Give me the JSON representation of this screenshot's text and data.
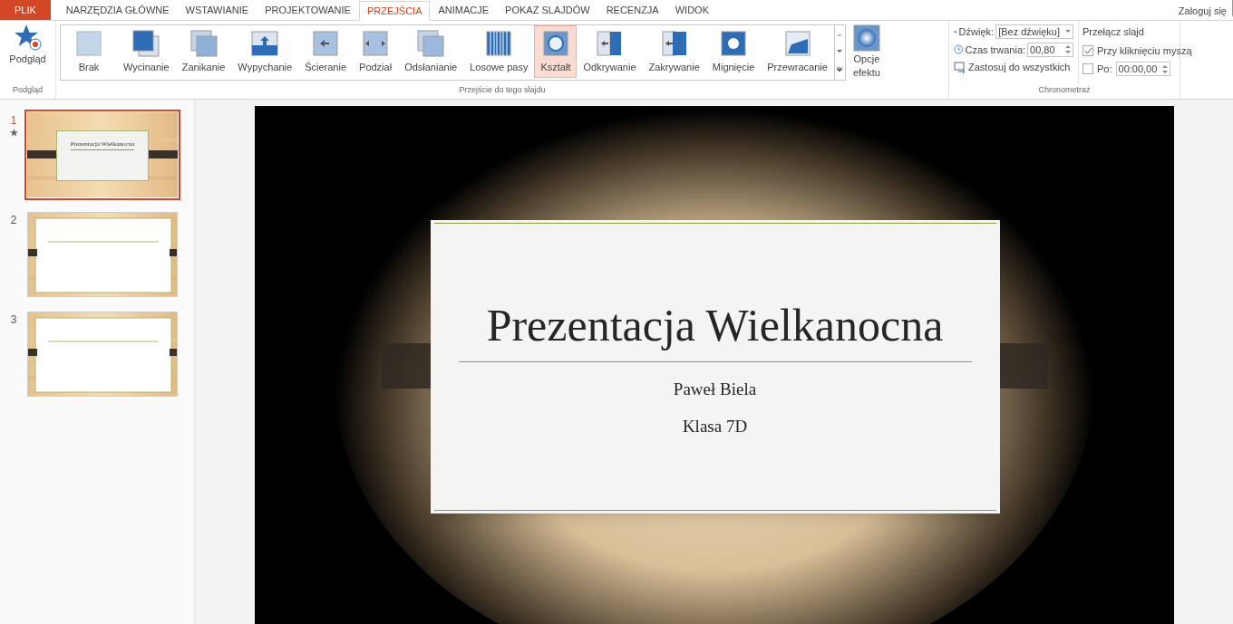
{
  "menu_tabs": [
    {
      "label": "PLIK",
      "kind": "file",
      "selected": false
    },
    {
      "label": "NARZĘDZIA GŁÓWNE",
      "kind": "tab",
      "selected": false
    },
    {
      "label": "WSTAWIANIE",
      "kind": "tab",
      "selected": false
    },
    {
      "label": "PROJEKTOWANIE",
      "kind": "tab",
      "selected": false
    },
    {
      "label": "PRZEJŚCIA",
      "kind": "tab",
      "selected": true
    },
    {
      "label": "ANIMACJE",
      "kind": "tab",
      "selected": false
    },
    {
      "label": "POKAZ SLAJDÓW",
      "kind": "tab",
      "selected": false
    },
    {
      "label": "RECENZJA",
      "kind": "tab",
      "selected": false
    },
    {
      "label": "WIDOK",
      "kind": "tab",
      "selected": false
    }
  ],
  "sign_in": "Zaloguj się",
  "preview": {
    "button": "Podgląd",
    "group": "Podgląd"
  },
  "transitions": {
    "group": "Przejście do tego slajdu",
    "items": [
      {
        "label": "Brak",
        "selected": false
      },
      {
        "label": "Wycinanie",
        "selected": false
      },
      {
        "label": "Zanikanie",
        "selected": false
      },
      {
        "label": "Wypychanie",
        "selected": false
      },
      {
        "label": "Ścieranie",
        "selected": false
      },
      {
        "label": "Podział",
        "selected": false
      },
      {
        "label": "Odsłanianie",
        "selected": false
      },
      {
        "label": "Losowe pasy",
        "selected": false
      },
      {
        "label": "Kształt",
        "selected": true
      },
      {
        "label": "Odkrywanie",
        "selected": false
      },
      {
        "label": "Zakrywanie",
        "selected": false
      },
      {
        "label": "Mignięcie",
        "selected": false
      },
      {
        "label": "Przewracanie",
        "selected": false
      }
    ],
    "effect_options": [
      "Opcje",
      "efektu"
    ]
  },
  "timing": {
    "group": "Chronometraż",
    "sound_label": "Dźwięk:",
    "sound_value": "[Bez dźwięku]",
    "duration_label": "Czas trwania:",
    "duration_value": "00,80",
    "apply_all": "Zastosuj do wszystkich",
    "advance_title": "Przełącz slajd",
    "on_click": {
      "label": "Przy kliknięciu myszą",
      "checked": true
    },
    "after": {
      "label": "Po:",
      "checked": false,
      "value": "00:00,00"
    }
  },
  "slides": [
    {
      "number": "1",
      "selected": true,
      "transition": true,
      "kind": "title",
      "title": "Prezentacja Wielkanocna"
    },
    {
      "number": "2",
      "selected": false,
      "transition": false,
      "kind": "blank"
    },
    {
      "number": "3",
      "selected": false,
      "transition": false,
      "kind": "blank"
    }
  ],
  "current_slide": {
    "title": "Prezentacja Wielkanocna",
    "lines": [
      "Paweł Biela",
      "Klasa 7D"
    ]
  }
}
